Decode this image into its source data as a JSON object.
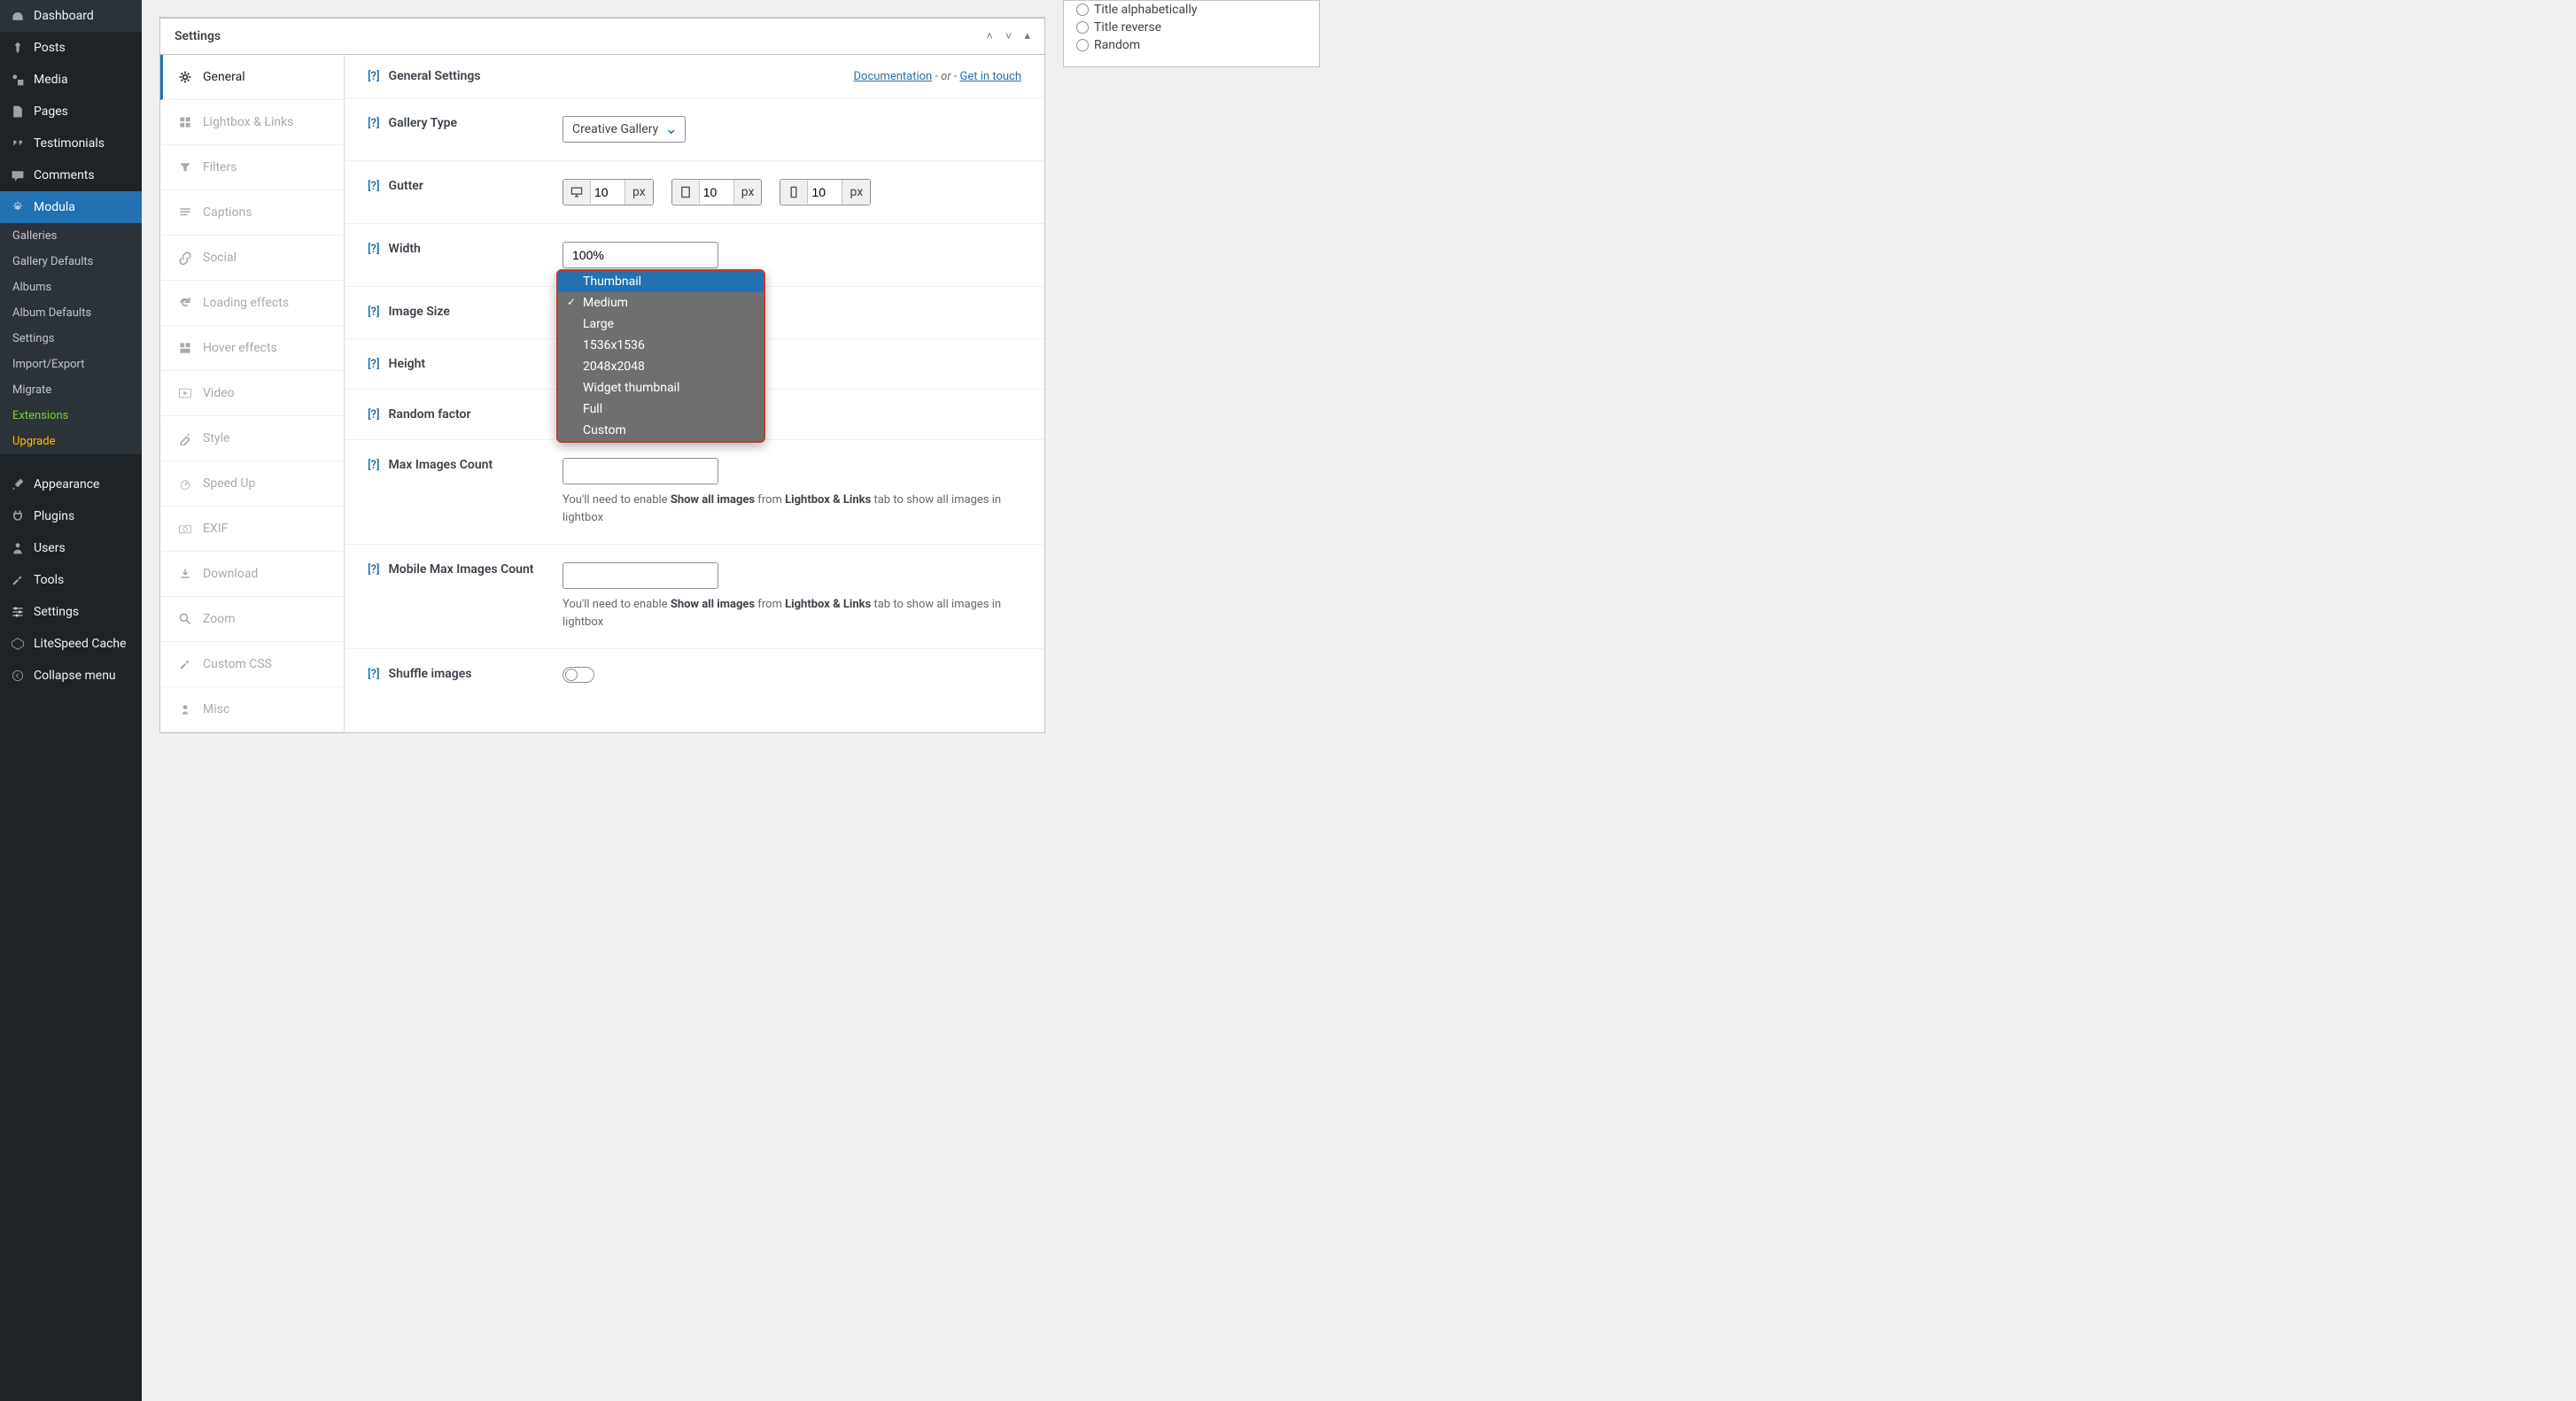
{
  "wp_menu": [
    {
      "label": "Dashboard",
      "icon": "dash"
    },
    {
      "label": "Posts",
      "icon": "pin"
    },
    {
      "label": "Media",
      "icon": "media"
    },
    {
      "label": "Pages",
      "icon": "pages"
    },
    {
      "label": "Testimonials",
      "icon": "quote"
    },
    {
      "label": "Comments",
      "icon": "comment"
    },
    {
      "label": "Modula",
      "icon": "modula",
      "active": true
    }
  ],
  "wp_sub": [
    {
      "label": "Galleries"
    },
    {
      "label": "Gallery Defaults"
    },
    {
      "label": "Albums"
    },
    {
      "label": "Album Defaults"
    },
    {
      "label": "Settings"
    },
    {
      "label": "Import/Export"
    },
    {
      "label": "Migrate"
    },
    {
      "label": "Extensions",
      "cls": "ext"
    },
    {
      "label": "Upgrade",
      "cls": "upg"
    }
  ],
  "wp_menu2": [
    {
      "label": "Appearance",
      "icon": "brush"
    },
    {
      "label": "Plugins",
      "icon": "plug"
    },
    {
      "label": "Users",
      "icon": "user"
    },
    {
      "label": "Tools",
      "icon": "wrench"
    },
    {
      "label": "Settings",
      "icon": "sliders"
    },
    {
      "label": "LiteSpeed Cache",
      "icon": "ls"
    },
    {
      "label": "Collapse menu",
      "icon": "collapse"
    }
  ],
  "panel": {
    "title": "Settings"
  },
  "tabs": [
    {
      "label": "General",
      "active": true,
      "icon": "gear"
    },
    {
      "label": "Lightbox & Links",
      "icon": "grid"
    },
    {
      "label": "Filters",
      "icon": "filter"
    },
    {
      "label": "Captions",
      "icon": "caption"
    },
    {
      "label": "Social",
      "icon": "link"
    },
    {
      "label": "Loading effects",
      "icon": "reload"
    },
    {
      "label": "Hover effects",
      "icon": "hover"
    },
    {
      "label": "Video",
      "icon": "play"
    },
    {
      "label": "Style",
      "icon": "style"
    },
    {
      "label": "Speed Up",
      "icon": "speed"
    },
    {
      "label": "EXIF",
      "icon": "camera"
    },
    {
      "label": "Download",
      "icon": "download"
    },
    {
      "label": "Zoom",
      "icon": "zoom"
    },
    {
      "label": "Custom CSS",
      "icon": "wrench2"
    },
    {
      "label": "Misc",
      "icon": "misc"
    }
  ],
  "header": {
    "title": "General Settings",
    "doc": "Documentation",
    "or": "- or -",
    "contact": "Get in touch",
    "help": "[?]"
  },
  "fields": {
    "gallery_type": {
      "label": "Gallery Type",
      "value": "Creative Gallery"
    },
    "gutter": {
      "label": "Gutter",
      "unit": "px",
      "values": [
        "10",
        "10",
        "10"
      ]
    },
    "width": {
      "label": "Width",
      "value": "100%"
    },
    "image_size": {
      "label": "Image Size"
    },
    "height": {
      "label": "Height"
    },
    "random": {
      "label": "Random factor"
    },
    "max_images": {
      "label": "Max Images Count"
    },
    "mobile_max": {
      "label": "Mobile Max Images Count"
    },
    "shuffle": {
      "label": "Shuffle images"
    },
    "hint_pre": "You'll need to enable ",
    "hint_b1": "Show all images",
    "hint_mid": " from ",
    "hint_b2": "Lightbox & Links",
    "hint_post": " tab to show all images in lightbox"
  },
  "dropdown": {
    "options": [
      {
        "label": "Thumbnail",
        "highlighted": true
      },
      {
        "label": "Medium",
        "checked": true
      },
      {
        "label": "Large"
      },
      {
        "label": "1536x1536"
      },
      {
        "label": "2048x2048"
      },
      {
        "label": "Widget thumbnail"
      },
      {
        "label": "Full"
      },
      {
        "label": "Custom"
      }
    ]
  },
  "side_radios": [
    {
      "label": "Title alphabetically"
    },
    {
      "label": "Title reverse"
    },
    {
      "label": "Random"
    }
  ]
}
